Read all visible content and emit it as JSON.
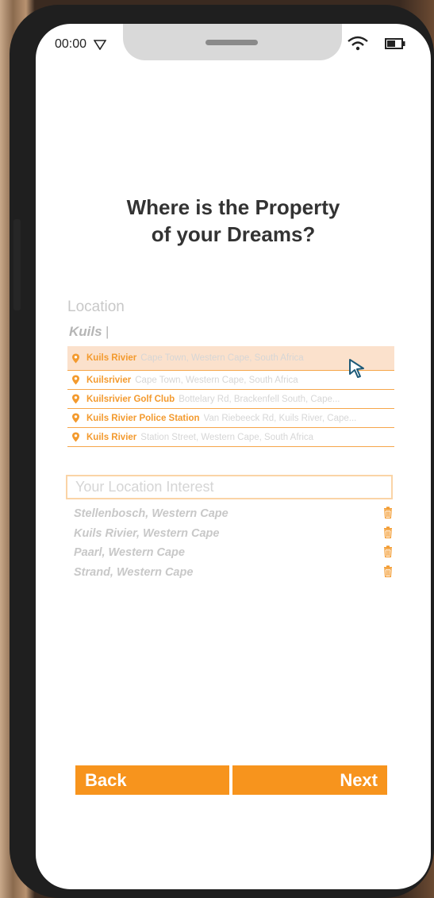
{
  "status_bar": {
    "time": "00:00"
  },
  "title": {
    "line1": "Where is the Property",
    "line2": "of your Dreams?"
  },
  "location": {
    "label": "Location",
    "query": "Kuils",
    "suggestions": [
      {
        "name": "Kuils Rivier",
        "address": "Cape Town, Western Cape, South Africa",
        "highlighted": true
      },
      {
        "name": "Kuilsrivier",
        "address": "Cape Town, Western Cape, South Africa",
        "highlighted": false
      },
      {
        "name": "Kuilsrivier Golf Club",
        "address": "Bottelary Rd, Brackenfell South, Cape...",
        "highlighted": false
      },
      {
        "name": "Kuils Rivier Police Station",
        "address": "Van Riebeeck Rd, Kuils River, Cape...",
        "highlighted": false
      },
      {
        "name": "Kuils Rivier",
        "address": "Station Street, Western Cape, South Africa",
        "highlighted": false
      }
    ]
  },
  "interest": {
    "placeholder": "Your Location Interest",
    "items": [
      "Stellenbosch, Western Cape",
      "Kuils Rivier, Western Cape",
      "Paarl, Western Cape",
      "Strand, Western Cape"
    ]
  },
  "buttons": {
    "back": "Back",
    "next": "Next"
  },
  "colors": {
    "accent": "#f7941d",
    "highlight": "#fbe1cc",
    "divider": "#f6a64a"
  },
  "icons": {
    "pin": "map-pin-icon",
    "trash": "trash-icon",
    "cursor": "mouse-cursor-icon"
  }
}
